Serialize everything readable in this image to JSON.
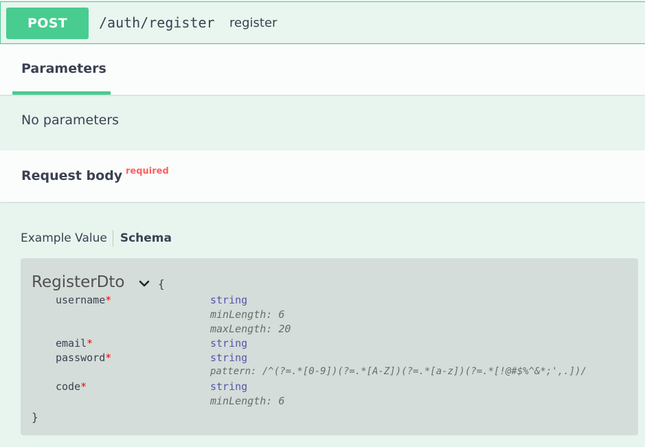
{
  "operation": {
    "method": "POST",
    "path": "/auth/register",
    "summary": "register"
  },
  "parameters": {
    "tab_label": "Parameters",
    "empty_text": "No parameters"
  },
  "request_body": {
    "title": "Request body",
    "required_label": "required",
    "tabs": {
      "example": "Example Value",
      "schema": "Schema"
    }
  },
  "schema": {
    "name": "RegisterDto",
    "open_brace": "{",
    "close_brace": "}",
    "required_marker": "*",
    "properties": [
      {
        "name": "username",
        "type": "string",
        "meta": [
          "minLength: 6",
          "maxLength: 20"
        ]
      },
      {
        "name": "email",
        "type": "string",
        "meta": []
      },
      {
        "name": "password",
        "type": "string",
        "meta": [
          "pattern: /^(?=.*[0-9])(?=.*[A-Z])(?=.*[a-z])(?=.*[!@#$%^&*;',.])/"
        ]
      },
      {
        "name": "code",
        "type": "string",
        "meta": [
          "minLength: 6"
        ]
      }
    ]
  },
  "colors": {
    "post_accent": "#49cc90",
    "required_red": "#ff6060",
    "type_blue": "#55a"
  },
  "icons": {
    "model_toggle": "chevron-down-icon"
  }
}
